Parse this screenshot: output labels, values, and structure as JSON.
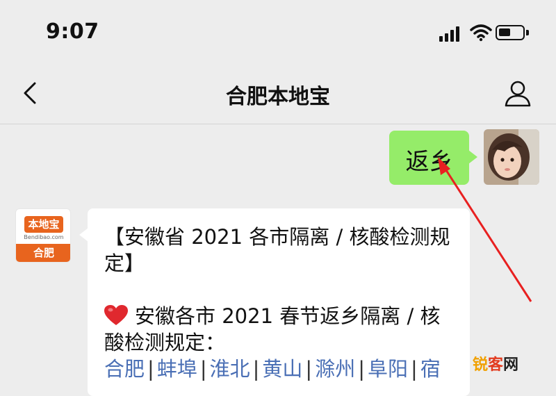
{
  "status_bar": {
    "time": "9:07"
  },
  "nav": {
    "title": "合肥本地宝"
  },
  "conversation": {
    "sent_message": "返乡",
    "account_logo": {
      "badge_text": "本地宝",
      "sub_text": "Bendibao.com",
      "city": "合肥"
    },
    "received": {
      "title": "【安徽省 2021 各市隔离 / 核酸检测规定】",
      "subtitle": "安徽各市 2021 春节返乡隔离 / 核酸检测规定：",
      "city_links": [
        "合肥",
        "蚌埠",
        "淮北",
        "黄山",
        "滁州",
        "阜阳",
        "宿"
      ]
    }
  },
  "watermark": {
    "part1": "锐",
    "part2": "客",
    "part3": "网"
  },
  "colors": {
    "sent_bubble": "#95ec69",
    "link": "#4a6fb5",
    "accent": "#e8641e",
    "arrow": "#e82020"
  }
}
